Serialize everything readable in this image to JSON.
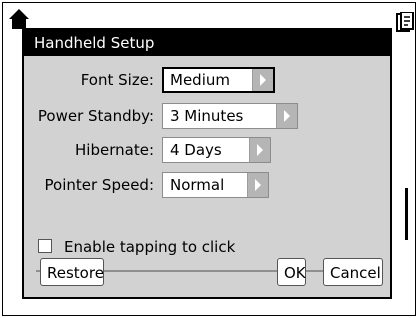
{
  "dialog": {
    "title": "Handheld Setup",
    "settings": [
      {
        "label": "Font Size:",
        "value": "Medium"
      },
      {
        "label": "Power Standby:",
        "value": "3 Minutes"
      },
      {
        "label": "Hibernate:",
        "value": "4 Days"
      },
      {
        "label": "Pointer Speed:",
        "value": "Normal"
      }
    ],
    "tap_to_click": {
      "label": "Enable tapping to click",
      "checked": false
    },
    "buttons": {
      "restore": "Restore",
      "ok": "OK",
      "cancel": "Cancel"
    }
  },
  "icons": {
    "home": "home-icon",
    "document": "document-icon"
  },
  "colors": {
    "title_bar": "#000000",
    "dialog_bg": "#d2d2d2",
    "arrow_bg": "#b5b5b5"
  }
}
